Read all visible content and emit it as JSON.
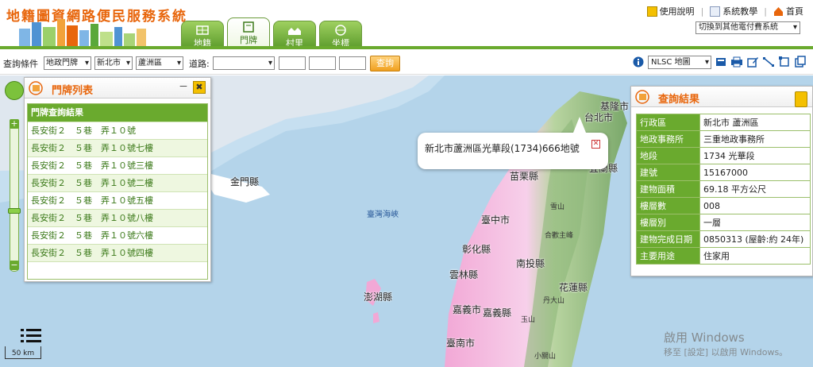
{
  "app": {
    "title": "地籍圖資網路便民服務系統"
  },
  "tabs": [
    {
      "label": "地籍",
      "active": false
    },
    {
      "label": "門牌",
      "active": true
    },
    {
      "label": "村里",
      "active": false
    },
    {
      "label": "坐標",
      "active": false
    }
  ],
  "top_links": {
    "help": "使用說明",
    "tutorial": "系統教學",
    "home": "首頁"
  },
  "switch_system": "切換到其他電付費系統",
  "query": {
    "label": "查詢條件",
    "type_select": "地政門牌",
    "city_select": "新北市",
    "district_select": "蘆洲區",
    "road_label": "道路:",
    "road_select": "",
    "button": "查詢"
  },
  "map_tools": {
    "basemap": "NLSC 地圖"
  },
  "list_panel": {
    "title": "門牌列表",
    "min_label": "－",
    "close_label": "✖",
    "table_header": "門牌查詢結果",
    "rows": [
      "長安街２　５巷　弄１０號",
      "長安街２　５巷　弄１０號七樓",
      "長安街２　５巷　弄１０號三樓",
      "長安街２　５巷　弄１０號二樓",
      "長安街２　５巷　弄１０號五樓",
      "長安街２　５巷　弄１０號八樓",
      "長安街２　５巷　弄１０號六樓",
      "長安街２　５巷　弄１０號四樓"
    ]
  },
  "popup": {
    "text": "新北市蘆洲區光華段(1734)666地號"
  },
  "result_panel": {
    "title": "查詢結果",
    "rows": [
      {
        "k": "行政區",
        "v": "新北市 蘆洲區"
      },
      {
        "k": "地政事務所",
        "v": "三重地政事務所"
      },
      {
        "k": "地段",
        "v": "1734 光華段"
      },
      {
        "k": "建號",
        "v": "15167000"
      },
      {
        "k": "建物面積",
        "v": "69.18 平方公尺"
      },
      {
        "k": "樓層數",
        "v": "008"
      },
      {
        "k": "樓層別",
        "v": "一層"
      },
      {
        "k": "建物完成日期",
        "v": "0850313 (屋齡:約 24年)"
      },
      {
        "k": "主要用途",
        "v": "住家用"
      }
    ]
  },
  "map_labels": {
    "keelung": "基隆市",
    "taipei": "台北市",
    "yilan": "宜蘭縣",
    "miaoli": "苗栗縣",
    "taichung": "臺中市",
    "changhua": "彰化縣",
    "nantou": "南投縣",
    "yunlin": "雲林縣",
    "hualien": "花蓮縣",
    "chiayi_city": "嘉義市",
    "chiayi_county": "嘉義縣",
    "tainan": "臺南市",
    "penghu": "澎湖縣",
    "kinmen": "金門縣",
    "strait": "臺灣海峽",
    "mt1": "雪山",
    "mt2": "合歡主峰",
    "mt3": "丹大山",
    "mt4": "玉山",
    "mt5": "小關山"
  },
  "scale": "50 km",
  "watermark": {
    "line1": "啟用 Windows",
    "line2": "移至 [設定] 以啟用 Windows。"
  }
}
